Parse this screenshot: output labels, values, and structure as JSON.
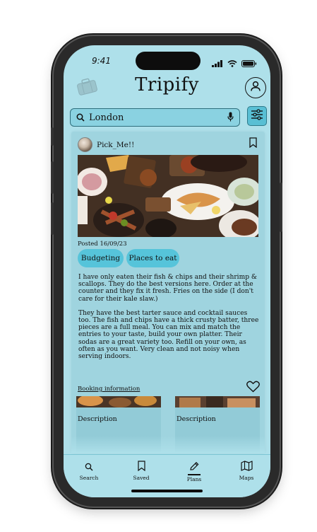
{
  "status_bar": {
    "time": "9:41"
  },
  "header": {
    "app_title": "Tripify"
  },
  "search": {
    "value": "London"
  },
  "post": {
    "username": "Pick_Me!!",
    "posted_date": "Posted 16/09/23",
    "tags": [
      "Budgeting",
      "Places to eat"
    ],
    "review_paragraphs": [
      "I have only eaten their fish & chips and their shrimp & scallops. They do the best versions here. Order at the counter and they fix it fresh. Fries on the side (I don't care for their kale slaw.)",
      "They have the best tarter sauce and cocktail sauces too. The fish and chips have a thick crusty batter, three pieces are a full meal. You can mix and match the entries to your taste, build your own platter. Their sodas are a great variety too. Refill on your own, as often as you want. Very clean and not noisy when serving indoors."
    ],
    "booking_link": "Booking information",
    "related": [
      {
        "description": "Description"
      },
      {
        "description": "Description"
      }
    ]
  },
  "nav": {
    "items": [
      {
        "label": "Search",
        "icon": "search-icon"
      },
      {
        "label": "Saved",
        "icon": "bookmark-icon"
      },
      {
        "label": "Plans",
        "icon": "pencil-icon"
      },
      {
        "label": "Maps",
        "icon": "map-icon"
      }
    ],
    "active": "Plans"
  },
  "colors": {
    "screen_bg": "#aee0ea",
    "card_bg": "#9fd4df",
    "tag_bg": "#56c4da",
    "search_bg": "#8ad2e1",
    "filter_bg": "#59bfd4"
  }
}
